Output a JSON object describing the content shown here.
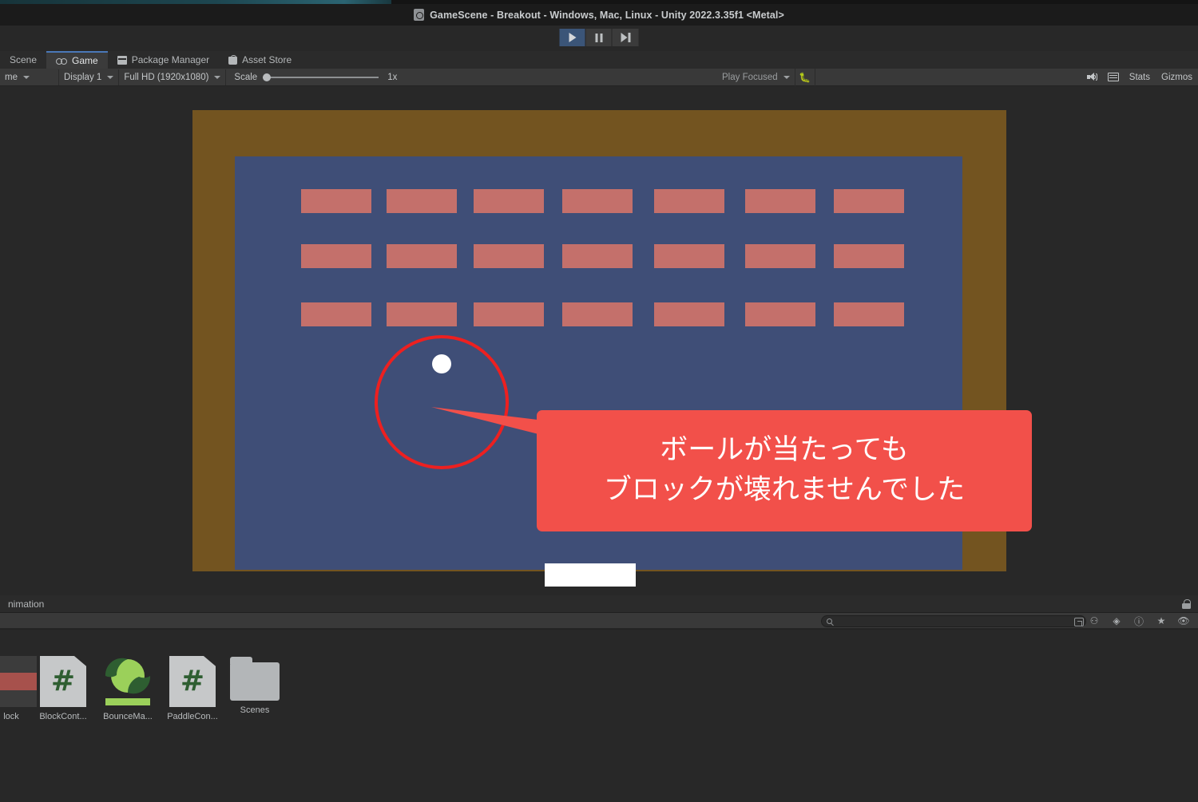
{
  "window": {
    "title": "GameScene - Breakout - Windows, Mac, Linux - Unity 2022.3.35f1 <Metal>",
    "doc_icon": "unity-scene-icon"
  },
  "transport": {
    "play_label": "play-button",
    "pause_label": "pause-button",
    "step_label": "step-button",
    "active": "play"
  },
  "tabs": [
    {
      "label": "Scene",
      "icon": "",
      "active": false
    },
    {
      "label": "Game",
      "icon": "game-icon",
      "active": true
    },
    {
      "label": "Package Manager",
      "icon": "package-icon",
      "active": false
    },
    {
      "label": "Asset Store",
      "icon": "store-icon",
      "active": false
    }
  ],
  "game_toolbar": {
    "view_mode": "me",
    "display": "Display 1",
    "resolution": "Full HD (1920x1080)",
    "scale_label": "Scale",
    "scale_value": "1x",
    "play_mode": "Play Focused",
    "stats_label": "Stats",
    "gizmos_label": "Gizmos",
    "mute_icon": "mute-audio-icon",
    "aspect_icon": "grid-icon",
    "bug_icon": "debug-icon"
  },
  "annotation": {
    "line1": "ボールが当たっても",
    "line2": "ブロックが壊れませんでした",
    "bubble_color": "#f2504a",
    "circle_color": "#ed2020"
  },
  "game_scene": {
    "border_color": "#735420",
    "field_color": "#3f4e77",
    "brick_color": "#c4706b",
    "ball_color": "#ffffff",
    "paddle_color": "#ffffff",
    "brick_rows": 3,
    "brick_cols": 7
  },
  "bottom_panel": {
    "tab_label": "nimation",
    "lock_icon": "lock-icon",
    "search_placeholder": "",
    "search_value": "",
    "toolbar_icons": [
      "open-in-new-icon",
      "filter-icon",
      "label-icon",
      "info-icon",
      "star-icon",
      "eye-icon"
    ]
  },
  "assets": [
    {
      "label": "lock",
      "type": "prefab",
      "glyph": ""
    },
    {
      "label": "BlockCont...",
      "type": "script",
      "glyph": "#"
    },
    {
      "label": "BounceMa...",
      "type": "material",
      "glyph": ""
    },
    {
      "label": "PaddleCon...",
      "type": "script",
      "glyph": "#"
    },
    {
      "label": "Scenes",
      "type": "folder",
      "glyph": ""
    }
  ]
}
